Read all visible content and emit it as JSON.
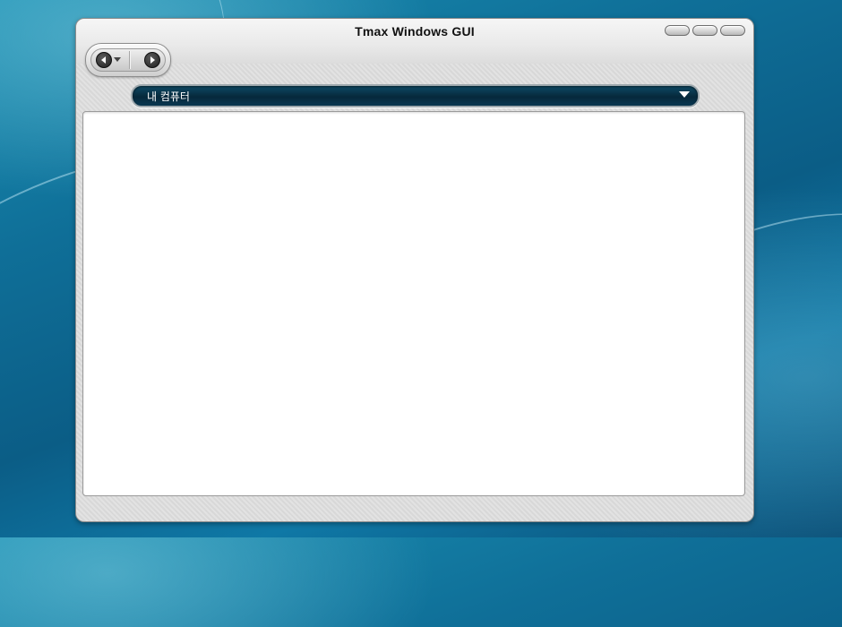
{
  "window": {
    "title": "Tmax Windows GUI"
  },
  "address_bar": {
    "location": "내 컴퓨터"
  },
  "icons": {
    "back": "back-arrow-icon",
    "history": "dropdown-triangle-icon",
    "forward": "forward-arrow-icon",
    "address_dropdown": "chevron-down-icon"
  },
  "colors": {
    "address_bar_bg": "#06283b",
    "desktop_bg": "#0f6f98"
  }
}
